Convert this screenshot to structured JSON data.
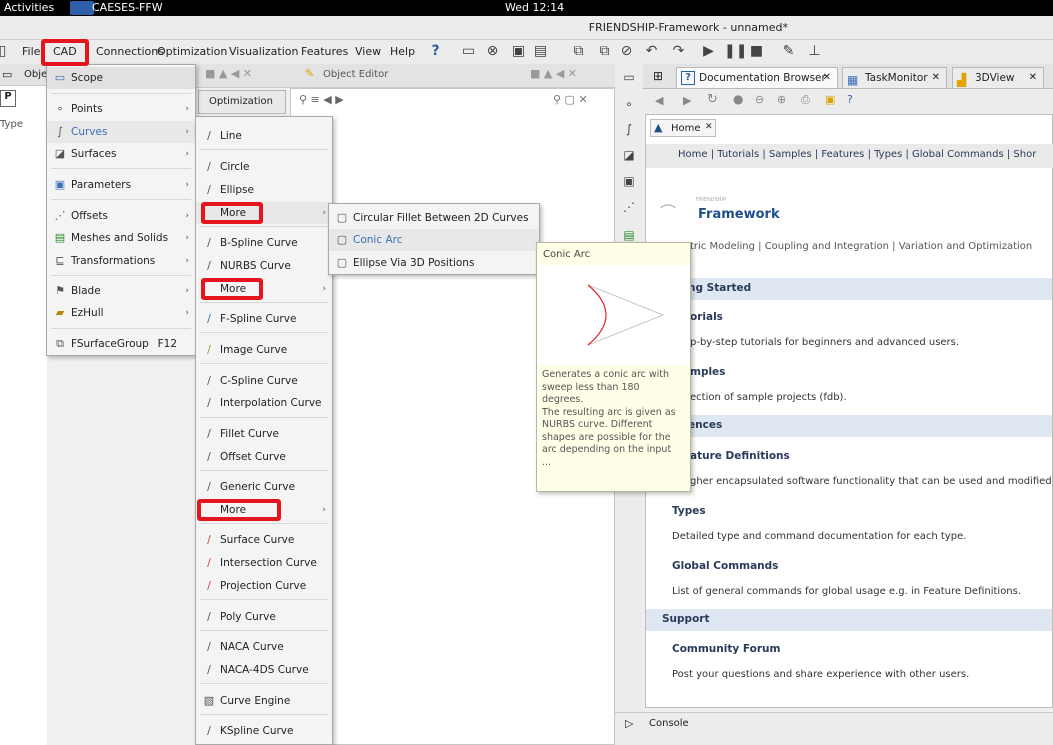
{
  "topbar": {
    "activities": "Activities",
    "app_name": "CAESES-FFW",
    "clock": "Wed 12:14"
  },
  "window": {
    "title": "FRIENDSHIP-Framework - unnamed*"
  },
  "menubar": {
    "items": [
      "File",
      "CAD",
      "Connections",
      "Optimization",
      "Visualization",
      "Features",
      "View",
      "Help"
    ]
  },
  "left_panel": {
    "tab_label": "Optimization",
    "header_label": "Obje",
    "type_label": "Type"
  },
  "object_editor": {
    "title": "Object Editor"
  },
  "cad_menu": {
    "items": [
      {
        "label": "Scope",
        "icon": "scope-icon"
      },
      {
        "label": "Points",
        "icon": "point-icon"
      },
      {
        "label": "Curves",
        "icon": "curve-icon"
      },
      {
        "label": "Surfaces",
        "icon": "surface-icon"
      },
      {
        "label": "Parameters",
        "icon": "parameter-icon"
      },
      {
        "label": "Offsets",
        "icon": "offset-icon"
      },
      {
        "label": "Meshes and Solids",
        "icon": "mesh-icon"
      },
      {
        "label": "Transformations",
        "icon": "transform-icon"
      },
      {
        "label": "Blade",
        "icon": "blade-icon"
      },
      {
        "label": "EzHull",
        "icon": "hull-icon"
      },
      {
        "label": "FSurfaceGroup",
        "icon": "surface-group-icon",
        "shortcut": "F12"
      }
    ]
  },
  "curves_menu": {
    "items": [
      "Line",
      "Circle",
      "Ellipse",
      "More",
      "B-Spline Curve",
      "NURBS Curve",
      "More",
      "F-Spline Curve",
      "Image Curve",
      "C-Spline Curve",
      "Interpolation Curve",
      "Fillet Curve",
      "Offset Curve",
      "Generic Curve",
      "More",
      "Surface Curve",
      "Intersection Curve",
      "Projection Curve",
      "Poly Curve",
      "NACA Curve",
      "NACA-4DS Curve",
      "Curve Engine",
      "KSpline Curve"
    ]
  },
  "more_menu": {
    "items": [
      "Circular Fillet Between 2D Curves",
      "Conic Arc",
      "Ellipse Via 3D Positions"
    ]
  },
  "tooltip": {
    "title": "Conic Arc",
    "lines": [
      "Generates a conic arc with",
      "sweep less than 180",
      "degrees.",
      "The resulting arc is given as",
      "NURBS curve. Different",
      "shapes are possible for the",
      "arc depending on the input",
      "..."
    ]
  },
  "right_tabs": [
    {
      "label": "Documentation Browser"
    },
    {
      "label": "TaskMonitor"
    },
    {
      "label": "3DView"
    }
  ],
  "doc": {
    "home_tab": "Home",
    "nav": "Home | Tutorials | Samples | Features | Types | Global Commands | Shor",
    "logo_small": "FRIENDSHIP",
    "logo": "Framework",
    "tagline": "tric Modeling | Coupling and Integration | Variation and Optimization",
    "sections": {
      "getting_started": "ng Started",
      "tutorials_h": "orials",
      "tutorials_p": "p-by-step tutorials for beginners and advanced users.",
      "samples_h": "mples",
      "samples_p": "ection of sample projects (fdb).",
      "references": "ences",
      "features_h": "ature Definitions",
      "features_p": "gher encapsulated software functionality that can be used and modified ind",
      "types_h": "Types",
      "types_p": "Detailed type and command documentation for each type.",
      "global_h": "Global Commands",
      "global_p": "List of general commands for global usage e.g. in Feature Definitions.",
      "support": "Support",
      "forum_h": "Community Forum",
      "forum_p": "Post your questions and share experience with other users."
    }
  },
  "console": {
    "label": "Console"
  },
  "colors": {
    "accent": "#3a6cb8",
    "marker": "#e5141d"
  }
}
